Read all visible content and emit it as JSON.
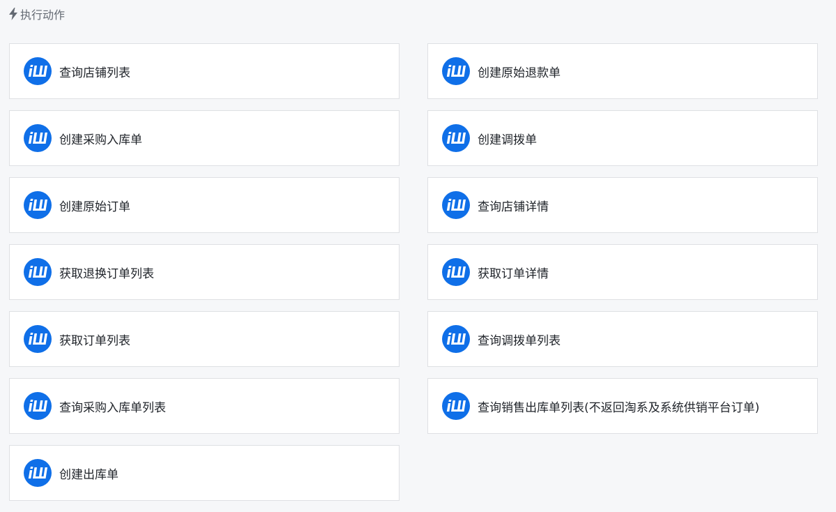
{
  "header": {
    "icon": "lightning-icon",
    "title": "执行动作"
  },
  "actions": [
    {
      "label": "查询店铺列表",
      "icon": "app-logo-icon"
    },
    {
      "label": "创建原始退款单",
      "icon": "app-logo-icon"
    },
    {
      "label": "创建采购入库单",
      "icon": "app-logo-icon"
    },
    {
      "label": "创建调拨单",
      "icon": "app-logo-icon"
    },
    {
      "label": "创建原始订单",
      "icon": "app-logo-icon"
    },
    {
      "label": "查询店铺详情",
      "icon": "app-logo-icon"
    },
    {
      "label": "获取退换订单列表",
      "icon": "app-logo-icon"
    },
    {
      "label": "获取订单详情",
      "icon": "app-logo-icon"
    },
    {
      "label": "获取订单列表",
      "icon": "app-logo-icon"
    },
    {
      "label": "查询调拨单列表",
      "icon": "app-logo-icon"
    },
    {
      "label": "查询采购入库单列表",
      "icon": "app-logo-icon"
    },
    {
      "label": "查询销售出库单列表(不返回淘系及系统供销平台订单)",
      "icon": "app-logo-icon"
    },
    {
      "label": "创建出库单",
      "icon": "app-logo-icon"
    }
  ],
  "colors": {
    "background": "#f6f7f9",
    "card_border": "#dee0e3",
    "logo_blue": "#0f6fe8",
    "header_text": "#646a73"
  }
}
